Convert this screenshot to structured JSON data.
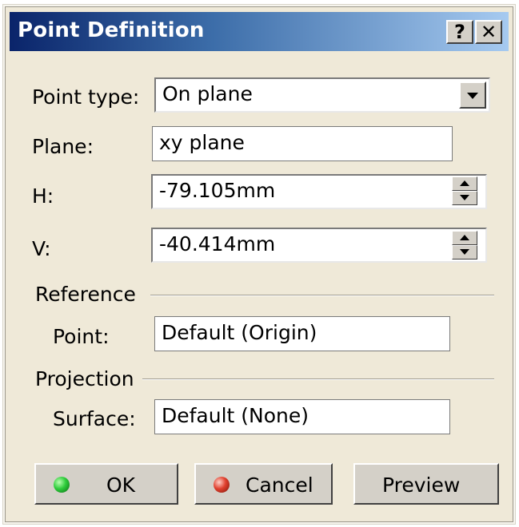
{
  "window": {
    "title": "Point Definition",
    "help_label": "?",
    "close_label": "✕"
  },
  "form": {
    "point_type_label": "Point type:",
    "point_type_value": "On plane",
    "plane_label": "Plane:",
    "plane_value": "xy plane",
    "h_label": "H:",
    "h_value": "-79.105mm",
    "v_label": "V:",
    "v_value": "-40.414mm"
  },
  "reference": {
    "group_label": "Reference",
    "point_label": "Point:",
    "point_value": "Default (Origin)"
  },
  "projection": {
    "group_label": "Projection",
    "surface_label": "Surface:",
    "surface_value": "Default (None)"
  },
  "buttons": {
    "ok_label": "OK",
    "cancel_label": "Cancel",
    "preview_label": "Preview"
  },
  "icons": {
    "ok": "green-led-icon",
    "cancel": "red-led-icon",
    "dropdown": "chevron-down-icon",
    "spinner": "spin-up-down-icon"
  },
  "colors": {
    "title_gradient_start": "#0a246a",
    "title_gradient_end": "#a6caf0",
    "dialog_bg": "#efe9d8"
  }
}
